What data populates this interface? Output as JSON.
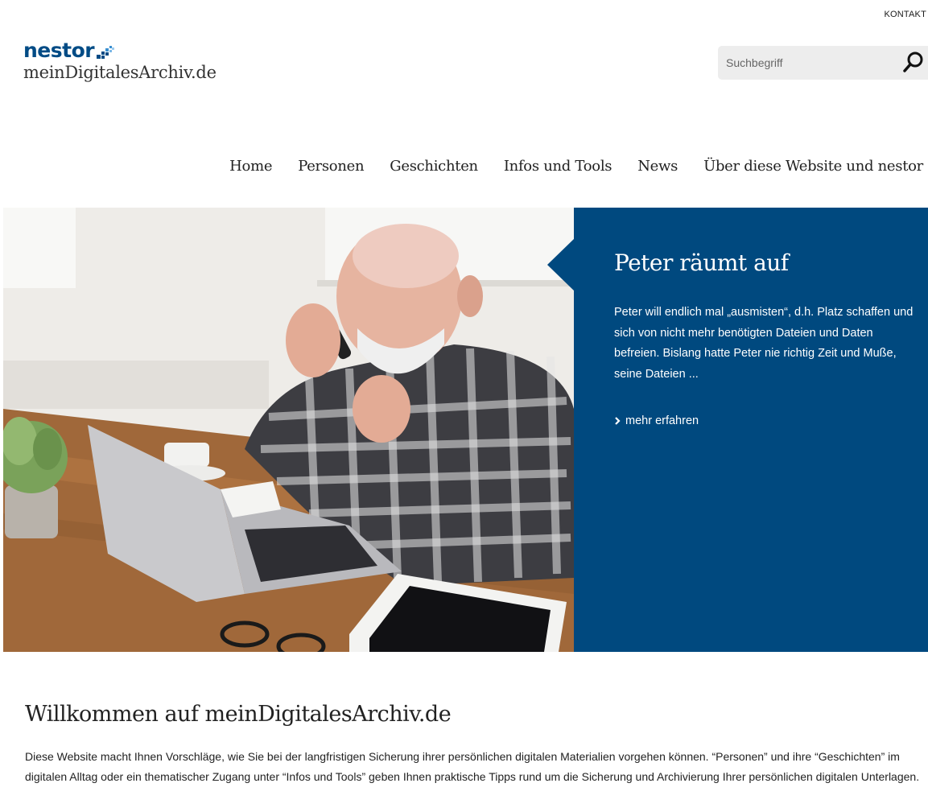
{
  "header": {
    "contact_link": "KONTAKT",
    "logo_brand": "nestor",
    "logo_subtitle": "meinDigitalesArchiv.de",
    "search_placeholder": "Suchbegriff"
  },
  "nav": {
    "items": [
      "Home",
      "Personen",
      "Geschichten",
      "Infos und Tools",
      "News",
      "Über diese Website und nestor"
    ]
  },
  "hero": {
    "title": "Peter räumt auf",
    "text": "Peter will endlich mal „ausmisten“, d.h. Platz schaffen und sich von nicht mehr benötigten Dateien und Daten befreien. Bislang hatte Peter nie richtig Zeit und Muße, seine Dateien ...",
    "more_link": "mehr erfahren",
    "panel_color": "#00497f"
  },
  "welcome": {
    "title": "Willkommen auf meinDigitalesArchiv.de",
    "text": "Diese Website macht Ihnen Vorschläge, wie Sie bei der langfristigen Sicherung ihrer persönlichen digitalen Materialien vorgehen können. “Personen” und ihre “Geschichten” im digitalen Alltag oder ein thematischer Zugang unter “Infos und Tools” geben Ihnen praktische Tipps rund um die Sicherung und Archivierung Ihrer persönlichen digitalen Unterlagen."
  },
  "icons": {
    "search": "search-icon",
    "logo_mark": "pixel-logo-icon",
    "more_arrow": "chevron-right-icon"
  },
  "colors": {
    "brand_blue": "#004b85",
    "panel_blue": "#00497f"
  }
}
